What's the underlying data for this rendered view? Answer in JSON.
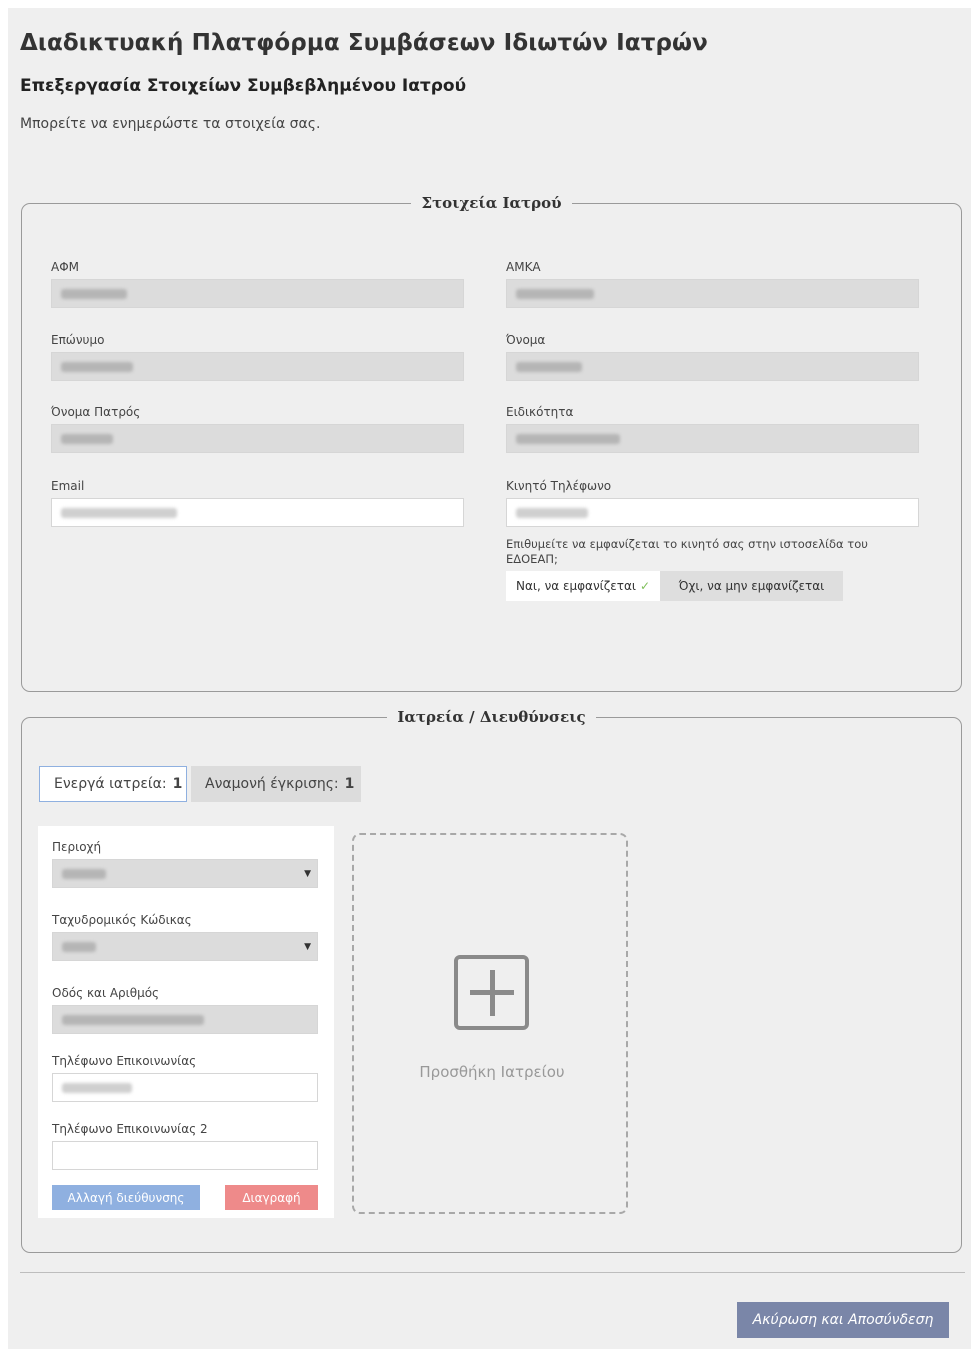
{
  "header": {
    "title": "Διαδικτυακή Πλατφόρμα Συμβάσεων Ιδιωτών Ιατρών",
    "subtitle": "Επεξεργασία Στοιχείων Συμβεβλημένου Ιατρού",
    "intro": "Μπορείτε να ενημερώστε τα στοιχεία σας."
  },
  "doctor": {
    "legend": "Στοιχεία Ιατρού",
    "afm_label": "ΑΦΜ",
    "amka_label": "ΑΜΚΑ",
    "surname_label": "Επώνυμο",
    "name_label": "Όνομα",
    "father_label": "Όνομα Πατρός",
    "specialty_label": "Ειδικότητα",
    "email_label": "Email",
    "mobile_label": "Κινητό Τηλέφωνο",
    "show_mobile_question": "Επιθυμείτε να εμφανίζεται το κινητό σας στην ιστοσελίδα του ΕΔΟΕΑΠ;",
    "show_yes": "Ναι, να εμφανίζεται",
    "show_yes_check": "✓",
    "show_no": "Όχι, να μην εμφανίζεται"
  },
  "offices": {
    "legend": "Ιατρεία / Διευθύνσεις",
    "tab_active_label": "Ενεργά ιατρεία:",
    "tab_active_count": "1",
    "tab_pending_label": "Αναμονή έγκρισης:",
    "tab_pending_count": "1",
    "area_label": "Περιοχή",
    "postcode_label": "Ταχυδρομικός Κώδικας",
    "street_label": "Οδός και Αριθμός",
    "phone_label": "Τηλέφωνο Επικοινωνίας",
    "phone2_label": "Τηλέφωνο Επικοινωνίας 2",
    "change_button": "Αλλαγή διεύθυνσης",
    "delete_button": "Διαγραφή",
    "add_office": "Προσθήκη Ιατρείου",
    "select_arrow": "▼"
  },
  "footer": {
    "cancel_button": "Ακύρωση και Αποσύνδεση"
  },
  "colors": {
    "page_bg": "#efefef",
    "readonly_bg": "#dcdcdc",
    "change_btn": "#8fb0e0",
    "delete_btn": "#ee8a8a",
    "cancel_btn": "#7a86a8"
  }
}
